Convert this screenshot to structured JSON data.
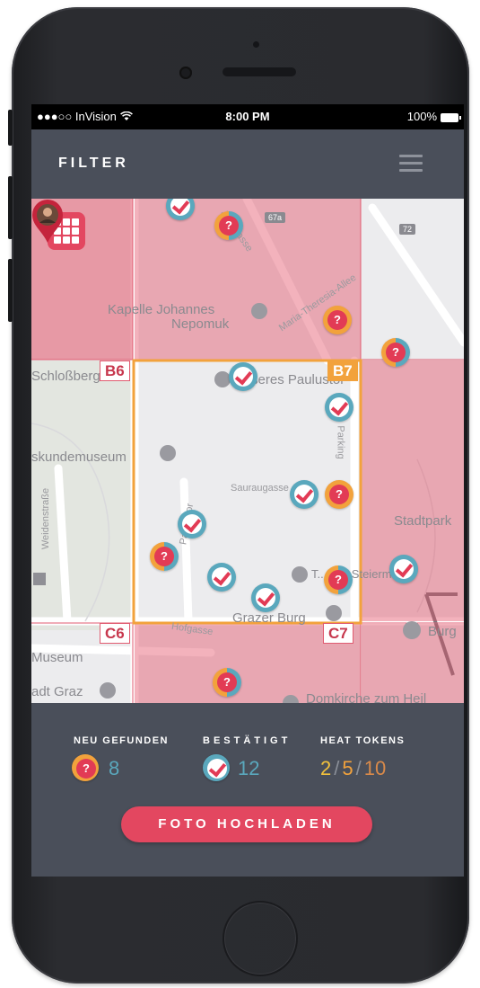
{
  "status_bar": {
    "carrier": "●●●○○ InVision",
    "wifi_icon": "wifi-icon",
    "time": "8:00 PM",
    "battery": "100%"
  },
  "nav": {
    "title": "FILTER",
    "menu_icon": "hamburger-menu-icon"
  },
  "map": {
    "grid_cells": {
      "b6": "B6",
      "b7": "B7",
      "c6": "C6",
      "c7": "C7"
    },
    "active_cell": "B7",
    "place_labels": {
      "kapelle": "Kapelle Johannes",
      "nepomuk": "Nepomuk",
      "schlossberg": "Schloßberg",
      "aeusseres": "Äußeres Paulustor",
      "kundemuseum": "skundemuseum",
      "weidenstrasse": "Weidenstraße",
      "sauraugasse": "Sauraugasse",
      "parking": "Parking",
      "paulustor": "Paulustor",
      "stadtpark": "Stadtpark",
      "grazer_burg": "Grazer Burg",
      "burgring": "Burg",
      "hofgasse": "Hofgasse",
      "museum": "Museum",
      "stadt_graz": "adt Graz",
      "jahngasse": "Jahngasse",
      "maria_theresia": "Maria-Theresia-Allee",
      "domkirche": "Domkirche zum Heil",
      "trauungssaal": "T...saal Steiermark",
      "burggasse": "Burggasse"
    },
    "road_badges": {
      "r67a": "67a",
      "r72": "72"
    },
    "colors": {
      "cell_fill": "#e34760",
      "active_border": "#f2a23c",
      "confirmed": "#5aa8bd",
      "unknown": "#f2a23c"
    }
  },
  "panel": {
    "new_found": {
      "label": "NEU GEFUNDEN",
      "value": "8"
    },
    "confirmed": {
      "label": "BESTÄTIGT",
      "value": "12"
    },
    "heat_tokens": {
      "label": "HEAT TOKENS",
      "current": "2",
      "sep1": "/",
      "mid": "5",
      "sep2": "/",
      "max": "10"
    },
    "upload_button": "FOTO HOCHLADEN"
  }
}
